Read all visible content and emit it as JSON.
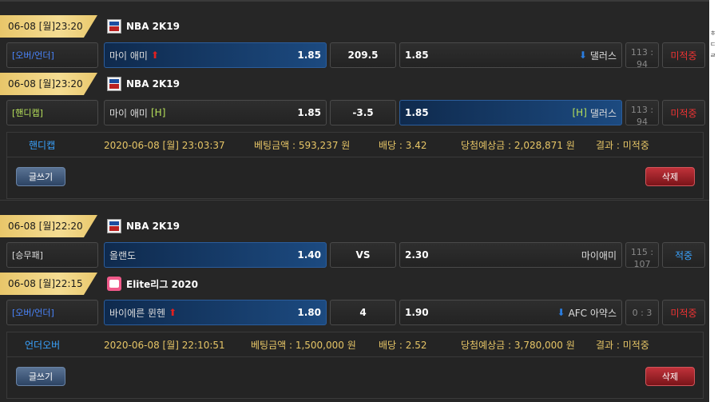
{
  "groups": [
    {
      "bets": [
        {
          "date": "06-08 [월]23:20",
          "league": "NBA 2K19",
          "league_icon": "nba-2k19-icon",
          "type": "[오버/언더]",
          "home": "마이 애미",
          "home_odds": "1.85",
          "line": "209.5",
          "away_odds": "1.85",
          "away": "댈러스",
          "score_line1": "113 :",
          "score_line2": "94",
          "status": "미적중"
        },
        {
          "date": "06-08 [월]23:20",
          "league": "NBA 2K19",
          "league_icon": "nba-2k19-icon",
          "type": "[핸디캡]",
          "home": "마이 애미",
          "home_mark": "[H]",
          "home_odds": "1.85",
          "line": "-3.5",
          "away_odds": "1.85",
          "away_mark": "[H]",
          "away": "댈러스",
          "score_line1": "113 :",
          "score_line2": "94",
          "status": "미적중"
        }
      ],
      "summary": {
        "type": "핸디캡",
        "datetime": "2020-06-08 [월] 23:03:37",
        "amount": "베팅금액 : 593,237 원",
        "odds": "배당 : 3.42",
        "expected": "당첨예상금 : 2,028,871 원",
        "result": "결과 : 미적중"
      },
      "write_label": "글쓰기",
      "delete_label": "삭제"
    },
    {
      "bets": [
        {
          "date": "06-08 [월]22:20",
          "league": "NBA 2K19",
          "league_icon": "nba-2k19-icon",
          "type": "[승무패]",
          "home": "올랜도",
          "home_odds": "1.40",
          "line": "VS",
          "away_odds": "2.30",
          "away": "마이애미",
          "score_line1": "115 :",
          "score_line2": "107",
          "status": "적중"
        },
        {
          "date": "06-08 [월]22:15",
          "league": "Elite리그 2020",
          "league_icon": "elite-league-icon",
          "type": "[오버/언더]",
          "home": "바이에른 뮌헨",
          "home_odds": "1.80",
          "line": "4",
          "away_odds": "1.90",
          "away": "AFC 아약스",
          "score_line1": "0 : 3",
          "score_line2": "",
          "status": "미적중"
        }
      ],
      "summary": {
        "type": "언더오버",
        "datetime": "2020-06-08 [월] 22:10:51",
        "amount": "베팅금액 : 1,500,000 원",
        "odds": "배당 : 2.52",
        "expected": "당첨예상금 : 3,780,000 원",
        "result": "결과 : 미적중"
      },
      "write_label": "글쓰기",
      "delete_label": "삭제"
    }
  ],
  "sidebar_text": [
    "ㅎ",
    "ㄷ",
    "ㄹ"
  ],
  "colors": {
    "date_tag": "#f0d585",
    "selected": "#1c4a80",
    "lose": "#e33333",
    "win": "#3aa3ff"
  }
}
